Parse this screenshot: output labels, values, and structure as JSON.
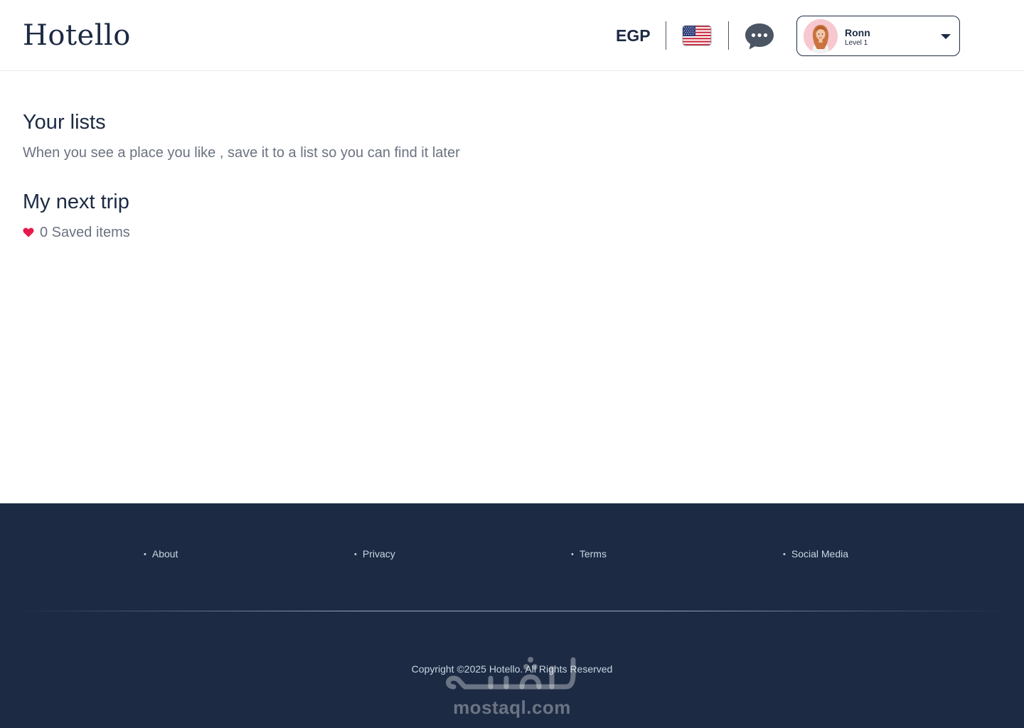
{
  "header": {
    "logo": "Hotello",
    "currency": "EGP",
    "language_icon": "us-flag-icon",
    "chat_icon": "chat-bubble-icon",
    "user": {
      "name": "Ronn",
      "level": "Level 1"
    }
  },
  "main": {
    "title": "Your lists",
    "subtitle": "When you see a place you like , save it to a list so you can find it later",
    "list": {
      "name": "My next trip",
      "saved_count_text": "0 Saved items",
      "heart_color": "#e8194a"
    }
  },
  "footer": {
    "links": [
      "About",
      "Privacy",
      "Terms",
      "Social Media"
    ],
    "copyright": "Copyright ©2025 Hotello. All Rights Reserved",
    "watermark": "mostaql.com"
  },
  "colors": {
    "brand_navy": "#1c2a43",
    "muted_text": "#6b7280",
    "footer_text": "#c9d6e3"
  }
}
